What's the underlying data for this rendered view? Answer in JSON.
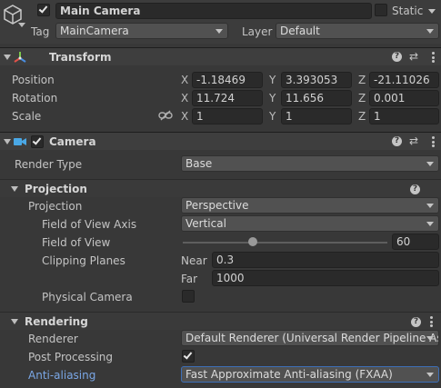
{
  "gameobject": {
    "name": "Main Camera",
    "static_label": "Static",
    "tag_label": "Tag",
    "tag_value": "MainCamera",
    "layer_label": "Layer",
    "layer_value": "Default",
    "active": true,
    "static": false
  },
  "transform": {
    "title": "Transform",
    "position_label": "Position",
    "rotation_label": "Rotation",
    "scale_label": "Scale",
    "position": {
      "x": "-1.18469",
      "y": "3.393053",
      "z": "-21.11026"
    },
    "rotation": {
      "x": "11.724",
      "y": "11.656",
      "z": "0.001"
    },
    "scale": {
      "x": "1",
      "y": "1",
      "z": "1"
    },
    "axis_x": "X",
    "axis_y": "Y",
    "axis_z": "Z"
  },
  "camera": {
    "title": "Camera",
    "enabled": true,
    "render_type_label": "Render Type",
    "render_type_value": "Base",
    "projection_section": "Projection",
    "projection_label": "Projection",
    "projection_value": "Perspective",
    "fov_axis_label": "Field of View Axis",
    "fov_axis_value": "Vertical",
    "fov_label": "Field of View",
    "fov_value": "60",
    "fov_slider_fraction": 0.34,
    "clipping_label": "Clipping Planes",
    "near_label": "Near",
    "near_value": "0.3",
    "far_label": "Far",
    "far_value": "1000",
    "physical_label": "Physical Camera",
    "physical_checked": false,
    "rendering_section": "Rendering",
    "renderer_label": "Renderer",
    "renderer_value": "Default Renderer (Universal Render Pipeline As",
    "post_label": "Post Processing",
    "post_checked": true,
    "aa_label": "Anti-aliasing",
    "aa_value": "Fast Approximate Anti-aliasing (FXAA)"
  },
  "colors": {
    "panel": "#383838",
    "field": "#2a2a2a",
    "dropdown": "#515151",
    "camera_icon": "#4aa8e6",
    "highlight_label": "#7aa7e6"
  }
}
